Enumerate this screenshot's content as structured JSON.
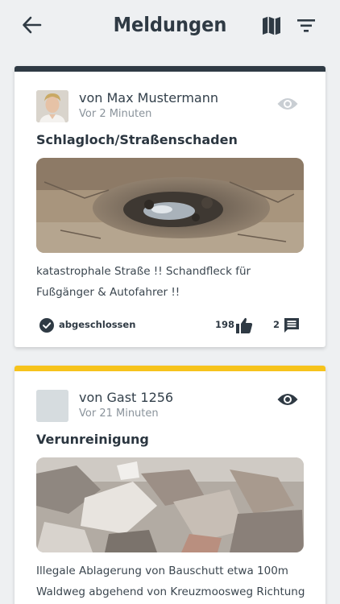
{
  "header": {
    "title": "Meldungen",
    "back_icon": "arrow-left-icon",
    "map_icon": "map-icon",
    "filter_icon": "filter-icon"
  },
  "colors": {
    "background": "#eef0f2",
    "text_dark": "#2f3a44",
    "stripe_closed": "#2f3a44",
    "stripe_open": "#f6c31c",
    "eye_inactive": "#c9ced3",
    "eye_active": "#2f3a44"
  },
  "reports": [
    {
      "author": "von Max Mustermann",
      "time": "Vor 2 Minuten",
      "title": "Schlagloch/Straßenschaden",
      "description": "katastrophale Straße !! Schandfleck für Fußgänger & Autofahrer !!",
      "status": "abgeschlossen",
      "likes": "198",
      "comments": "2",
      "image": "pothole-photo",
      "avatar": "user-photo"
    },
    {
      "author": "von Gast 1256",
      "time": "Vor 21 Minuten",
      "title": "Verunreinigung",
      "description": "Illegale Ablagerung von Bauschutt etwa 100m Waldweg abgehend von Kreuzmoosweg Richtung",
      "image": "rubble-photo",
      "avatar": "guest-placeholder"
    }
  ]
}
